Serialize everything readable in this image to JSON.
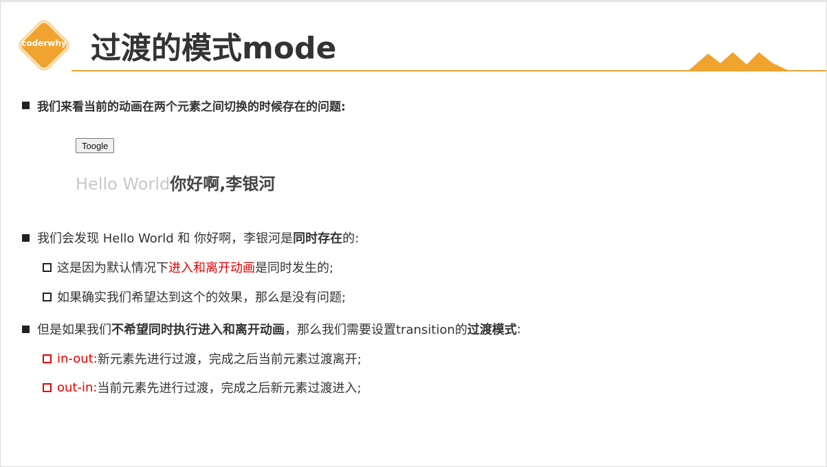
{
  "logo": {
    "text": "coderwhy"
  },
  "title": "过渡的模式mode",
  "colors": {
    "accent": "#f0a32e",
    "highlight": "#e60000",
    "text": "#333333"
  },
  "bullet1": {
    "text": "我们来看当前的动画在两个元素之间切换的时候存在的问题:"
  },
  "demo": {
    "button_label": "Toogle",
    "fading_text": "Hello World",
    "entering_text": "你好啊,李银河"
  },
  "bullet2": {
    "pre": "我们会发现 Hello World 和 你好啊，李银河是",
    "bold": "同时存在",
    "post": "的:",
    "sub1": {
      "pre": "这是因为默认情况下",
      "red": "进入和离开动画",
      "post": "是同时发生的;"
    },
    "sub2": {
      "text": "如果确实我们希望达到这个的效果，那么是没有问题;"
    }
  },
  "bullet3": {
    "pre": "但是如果我们",
    "bold1": "不希望同时执行进入和离开动画",
    "mid": "，那么我们需要设置transition的",
    "bold2": "过渡模式",
    "post": ":",
    "sub1": {
      "key": "in-out:",
      "desc": " 新元素先进行过渡，完成之后当前元素过渡离开;"
    },
    "sub2": {
      "key": "out-in:",
      "desc": " 当前元素先进行过渡，完成之后新元素过渡进入;"
    }
  }
}
